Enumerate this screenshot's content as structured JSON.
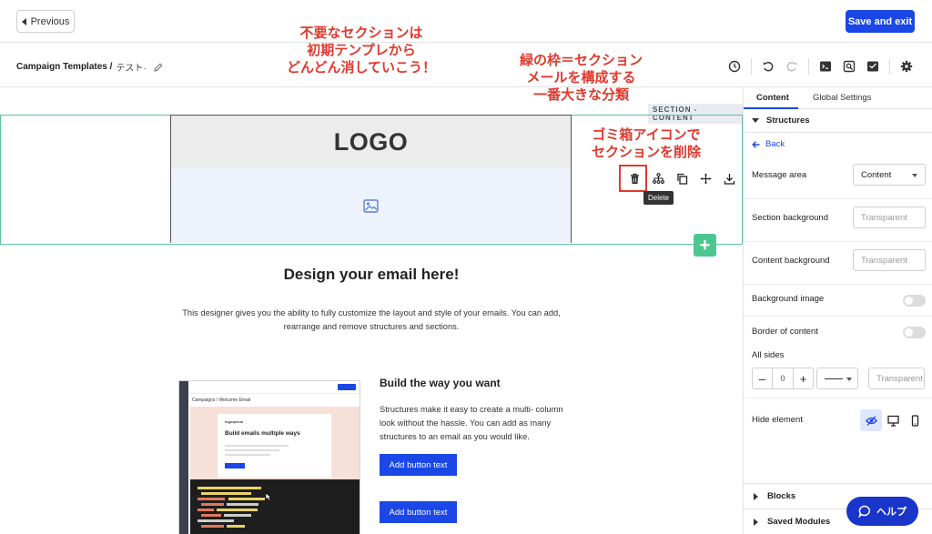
{
  "topbar": {
    "previous_label": "Previous",
    "save_label": "Save and exit"
  },
  "breadcrumb": {
    "root": "Campaign Templates /",
    "current": "テスト·"
  },
  "toolbar_icons": [
    "history-icon",
    "undo-icon",
    "redo-icon",
    "code-icon",
    "preview-icon",
    "test-email-icon",
    "settings-icon"
  ],
  "canvas": {
    "section_tag": "SECTION - CONTENT",
    "logo_text": "LOGO",
    "tooltip": "Delete",
    "section_toolbar": [
      "trash-icon",
      "structure-icon",
      "copy-icon",
      "move-icon",
      "save-icon"
    ],
    "heading": "Design your email here!",
    "intro": "This designer gives you the ability to fully customize the layout and style of your emails. You can add, rearrange and remove structures and sections.",
    "feature_title": "Build the way you want",
    "feature_text": "Structures make it easy to create a multi- column look without the hassle. You can add as many structures to an email as you would like.",
    "button1": "Add button text",
    "button2": "Add button text",
    "thumb_crumb": "Campaigns / Welcome Email",
    "thumb_logo": "logoipsum",
    "thumb_heading": "Build emails multiple ways"
  },
  "panel": {
    "tab_content": "Content",
    "tab_global": "Global Settings",
    "structures_label": "Structures",
    "back_label": "Back",
    "message_area_label": "Message area",
    "message_area_value": "Content",
    "section_bg_label": "Section background",
    "section_bg_placeholder": "Transparent",
    "content_bg_label": "Content background",
    "content_bg_placeholder": "Transparent",
    "bg_image_label": "Background image",
    "border_label": "Border of content",
    "all_sides_label": "All sides",
    "border_width": "0",
    "border_color_placeholder": "Transparent",
    "hide_label": "Hide element",
    "blocks_label": "Blocks",
    "saved_modules_label": "Saved Modules"
  },
  "help": {
    "label": "ヘルプ"
  },
  "annotations": {
    "a1_line1": "不要なセクションは",
    "a1_line2": "初期テンプレから",
    "a1_line3": "どんどん消していこう！",
    "a2_line1": "緑の枠＝セクション",
    "a2_line2": "メールを構成する",
    "a2_line3": "一番大きな分類",
    "a3_line1": "ゴミ箱アイコンで",
    "a3_line2": "セクションを削除"
  },
  "colors": {
    "accent": "#1a47e6",
    "section_border": "#5ec49a",
    "annotation": "#e0392d",
    "add_button": "#4cc790"
  }
}
